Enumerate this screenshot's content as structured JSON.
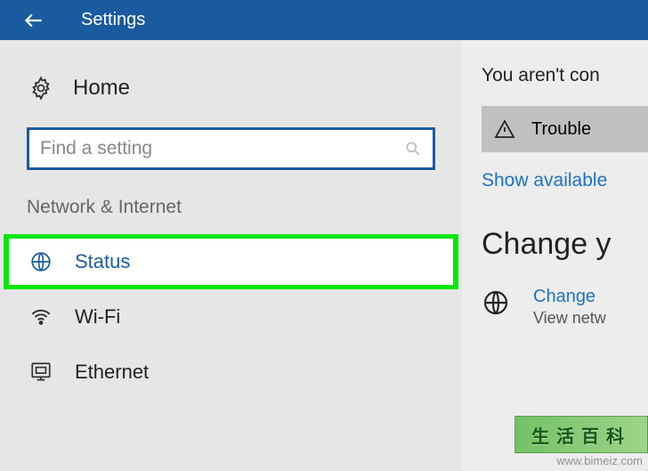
{
  "titlebar": {
    "title": "Settings"
  },
  "sidebar": {
    "home_label": "Home",
    "search_placeholder": "Find a setting",
    "category": "Network & Internet",
    "items": [
      {
        "label": "Status",
        "icon": "globe-grid-icon",
        "selected": true
      },
      {
        "label": "Wi-Fi",
        "icon": "wifi-icon",
        "selected": false
      },
      {
        "label": "Ethernet",
        "icon": "ethernet-icon",
        "selected": false
      }
    ]
  },
  "main": {
    "status_text": "You aren't con",
    "troubleshoot_label": "Trouble",
    "show_link": "Show available",
    "section_title": "Change y",
    "adapter_link": "Change ",
    "adapter_sub": "View netw"
  },
  "watermark": {
    "text": "www.bimeiz.com",
    "logo": "生活百科"
  }
}
